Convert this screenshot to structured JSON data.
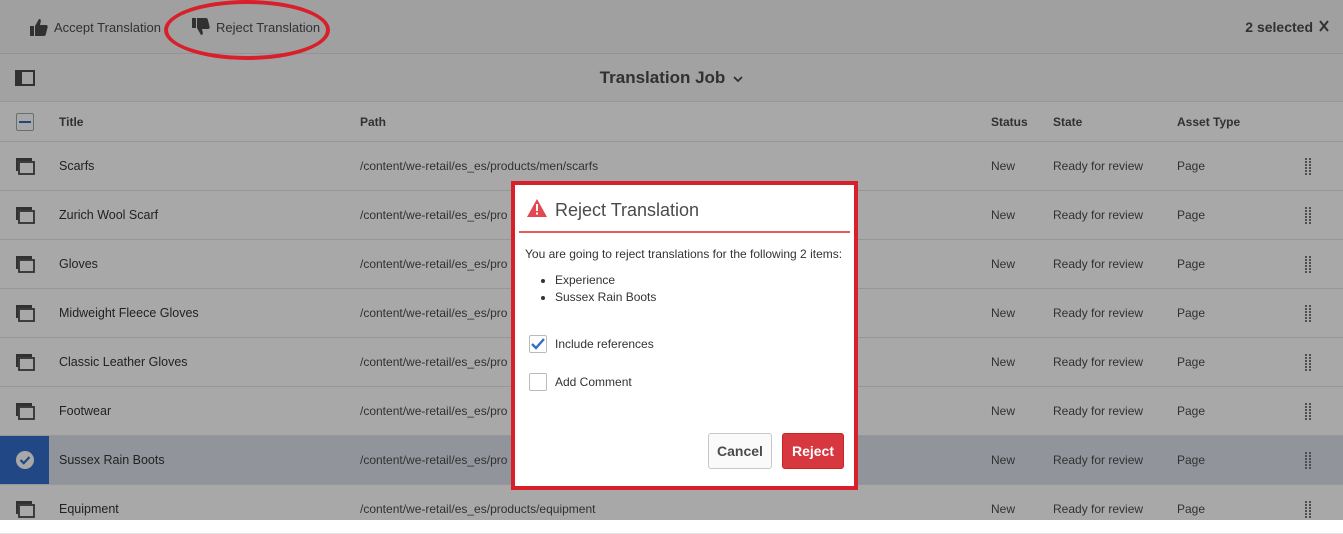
{
  "toolbar": {
    "accept_label": "Accept Translation",
    "reject_label": "Reject Translation",
    "selected_text": "2 selected"
  },
  "title_bar": {
    "job_title": "Translation Job"
  },
  "table": {
    "headers": {
      "title": "Title",
      "path": "Path",
      "status": "Status",
      "state": "State",
      "asset_type": "Asset Type"
    },
    "rows": [
      {
        "title": "Scarfs",
        "path": "/content/we-retail/es_es/products/men/scarfs",
        "status": "New",
        "state": "Ready for review",
        "asset_type": "Page",
        "selected": false
      },
      {
        "title": "Zurich Wool Scarf",
        "path": "/content/we-retail/es_es/pro",
        "status": "New",
        "state": "Ready for review",
        "asset_type": "Page",
        "selected": false
      },
      {
        "title": "Gloves",
        "path": "/content/we-retail/es_es/pro",
        "status": "New",
        "state": "Ready for review",
        "asset_type": "Page",
        "selected": false
      },
      {
        "title": "Midweight Fleece Gloves",
        "path": "/content/we-retail/es_es/pro",
        "status": "New",
        "state": "Ready for review",
        "asset_type": "Page",
        "selected": false
      },
      {
        "title": "Classic Leather Gloves",
        "path": "/content/we-retail/es_es/pro",
        "status": "New",
        "state": "Ready for review",
        "asset_type": "Page",
        "selected": false
      },
      {
        "title": "Footwear",
        "path": "/content/we-retail/es_es/pro",
        "status": "New",
        "state": "Ready for review",
        "asset_type": "Page",
        "selected": false
      },
      {
        "title": "Sussex Rain Boots",
        "path": "/content/we-retail/es_es/pro",
        "status": "New",
        "state": "Ready for review",
        "asset_type": "Page",
        "selected": true
      },
      {
        "title": "Equipment",
        "path": "/content/we-retail/es_es/products/equipment",
        "status": "New",
        "state": "Ready for review",
        "asset_type": "Page",
        "selected": false
      }
    ]
  },
  "dialog": {
    "title": "Reject Translation",
    "message": "You are going to reject translations for the following 2 items:",
    "items": [
      "Experience",
      "Sussex Rain Boots"
    ],
    "include_references_label": "Include references",
    "include_references_checked": true,
    "add_comment_label": "Add Comment",
    "add_comment_checked": false,
    "cancel_label": "Cancel",
    "reject_label": "Reject"
  },
  "colors": {
    "accent_blue": "#326ec8",
    "danger_red": "#d7373f",
    "annotation_red": "#d7202a"
  }
}
